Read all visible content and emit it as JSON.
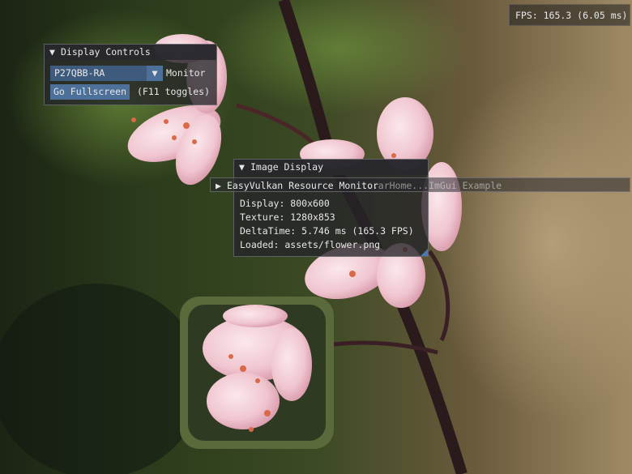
{
  "fps_overlay": {
    "text": "FPS: 165.3 (6.05 ms)"
  },
  "display_controls": {
    "title": "Display Controls",
    "monitor_value": "P27QBB-RA",
    "monitor_label": "Monitor",
    "fullscreen_button": "Go Fullscreen",
    "fullscreen_hint": "(F11 toggles)"
  },
  "image_display": {
    "title": "Image Display",
    "display": "Display: 800x600",
    "texture": "Texture: 1280x853",
    "delta_time": "DeltaTime: 5.746 ms (165.3 FPS)",
    "loaded": "Loaded: assets/flower.png"
  },
  "resource_monitor": {
    "title": "EasyVulkan Resource Monitor",
    "ghost_text": "...arHome...ImGui Example"
  },
  "icons": {
    "expanded": "triangle-down-icon",
    "collapsed": "triangle-right-icon",
    "dropdown": "chevron-down-icon"
  },
  "colors": {
    "button": "#4c7099",
    "combo": "#3e5a7c",
    "window_bg": "#242428"
  }
}
